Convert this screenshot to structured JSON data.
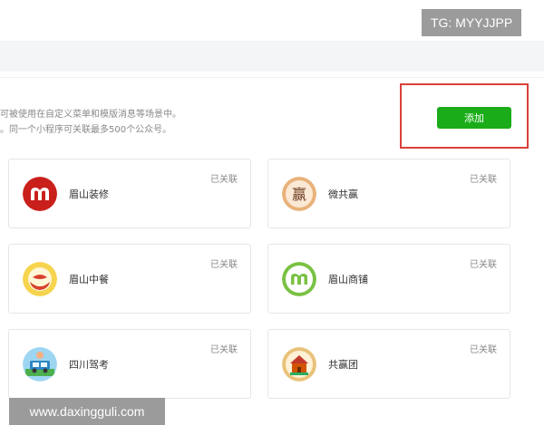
{
  "watermarks": {
    "top": "TG: MYYJJPP",
    "bottom": "www.daxingguli.com"
  },
  "description": {
    "line1": "可被使用在自定义菜单和模版消息等场景中。",
    "line2": "。同一个小程序可关联最多500个公众号。"
  },
  "add_button": {
    "label": "添加"
  },
  "cards": [
    {
      "name": "眉山装修",
      "status": "已关联",
      "icon": "m-logo-red"
    },
    {
      "name": "微共赢",
      "status": "已关联",
      "icon": "ying-character-logo"
    },
    {
      "name": "眉山中餐",
      "status": "已关联",
      "icon": "chinese-food-logo"
    },
    {
      "name": "眉山商铺",
      "status": "已关联",
      "icon": "m-logo-green"
    },
    {
      "name": "四川驾考",
      "status": "已关联",
      "icon": "driving-exam-logo"
    },
    {
      "name": "共赢团",
      "status": "已关联",
      "icon": "group-house-logo"
    }
  ],
  "colors": {
    "accent_green": "#1aad19",
    "highlight_red": "#d9413a",
    "brand_red": "#c9201b",
    "brand_green": "#7ac143"
  }
}
